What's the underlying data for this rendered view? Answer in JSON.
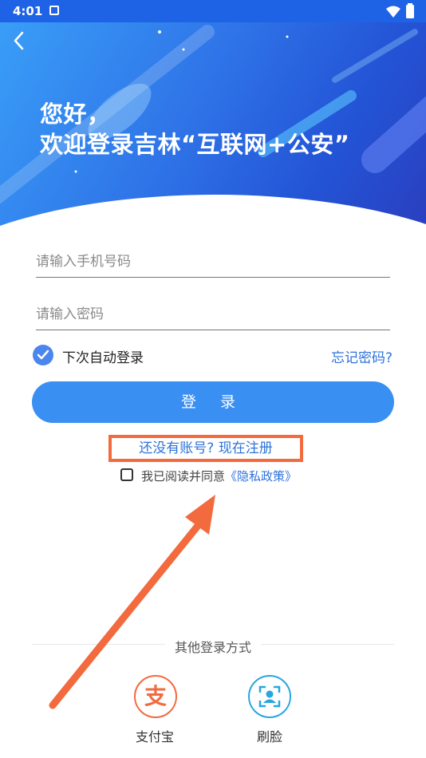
{
  "status_bar": {
    "time": "4:01"
  },
  "hero": {
    "line1": "您好，",
    "line2": "欢迎登录吉林“互联网+公安”"
  },
  "form": {
    "phone_placeholder": "请输入手机号码",
    "password_placeholder": "请输入密码",
    "auto_login_label": "下次自动登录",
    "auto_login_checked": true,
    "forgot_password": "忘记密码?",
    "login_button": "登 录",
    "register_link": "还没有账号? 现在注册",
    "agree_prefix": "我已阅读并同意",
    "privacy_policy": "《隐私政策》",
    "agree_checked": false
  },
  "other_login": {
    "title": "其他登录方式",
    "methods": [
      {
        "label": "支付宝",
        "icon": "alipay-icon",
        "glyph": "支",
        "color": "#f26a3d"
      },
      {
        "label": "刷脸",
        "icon": "face-scan-icon",
        "color": "#27a6e0"
      }
    ]
  },
  "colors": {
    "primary": "#3a8ff2",
    "link": "#2d73d9",
    "annotation": "#f26a3d"
  }
}
